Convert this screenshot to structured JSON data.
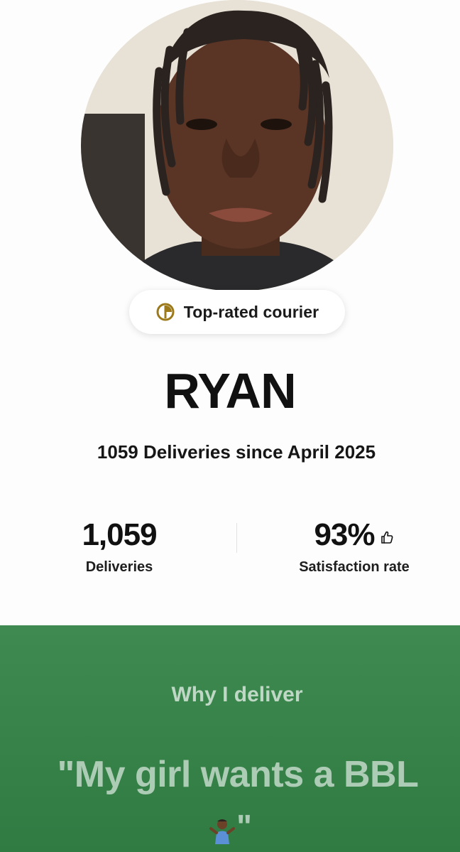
{
  "profile": {
    "name": "RYAN",
    "badge_label": "Top-rated courier",
    "deliveries_since": "1059 Deliveries since April 2025"
  },
  "stats": {
    "deliveries_value": "1,059",
    "deliveries_label": "Deliveries",
    "satisfaction_value": "93%",
    "satisfaction_label": "Satisfaction rate"
  },
  "why": {
    "title": "Why I deliver",
    "quote_line1": "\"My girl wants a BBL",
    "quote_end": "\""
  },
  "colors": {
    "green": "#3e8a50",
    "badge_gold": "#9c7a1c"
  },
  "icons": {
    "badge": "top-rated-medal-icon",
    "satisfaction": "thumbs-up-icon",
    "emoji": "person-shrugging-emoji"
  }
}
